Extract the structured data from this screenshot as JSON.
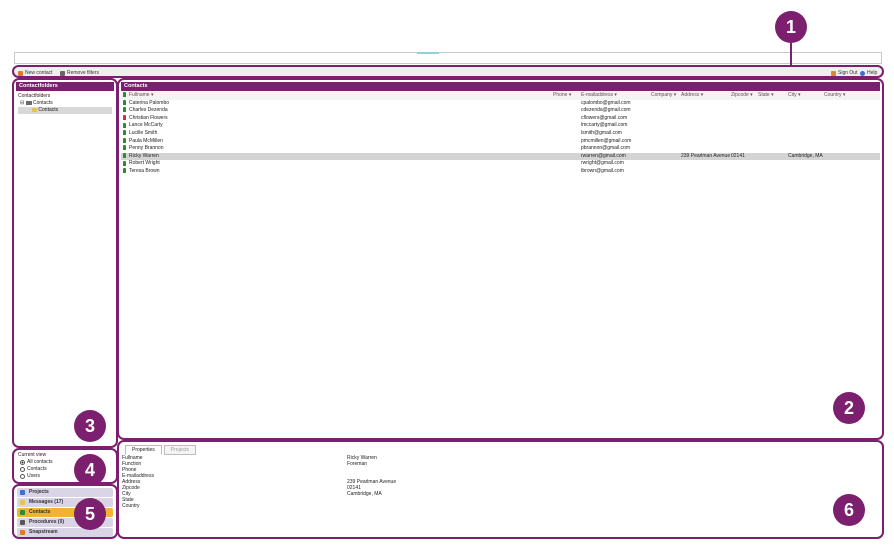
{
  "toolbar": {
    "new_contact": "New contact",
    "remove_filters": "Remove filters",
    "sign_out": "Sign Out",
    "help": "Help"
  },
  "folders": {
    "title": "Contactfolders",
    "tree": [
      "Contactfolders",
      "Contacts",
      "Contacts"
    ]
  },
  "contacts": {
    "title": "Contacts",
    "columns": [
      "Fullname",
      "Phone",
      "E-mailaddress",
      "Company",
      "Address",
      "Zipcode",
      "State",
      "City",
      "Country"
    ],
    "rows": [
      {
        "name": "Caterina Palombo",
        "email": "cpalombo@gmail.com",
        "address": "",
        "zip": "",
        "city": ""
      },
      {
        "name": "Charles Dezenda",
        "email": "cdezenda@gmail.com",
        "address": "",
        "zip": "",
        "city": ""
      },
      {
        "name": "Christian Flowers",
        "email": "cflowers@gmail.com",
        "address": "",
        "zip": "",
        "city": ""
      },
      {
        "name": "Lance McCarty",
        "email": "lmccarty@gmail.com",
        "address": "",
        "zip": "",
        "city": ""
      },
      {
        "name": "Lucille Smith",
        "email": "lsmith@gmail.com",
        "address": "",
        "zip": "",
        "city": ""
      },
      {
        "name": "Paula McMillen",
        "email": "pmcmillen@gmail.com",
        "address": "",
        "zip": "",
        "city": ""
      },
      {
        "name": "Penny Brannon",
        "email": "pbrannon@gmail.com",
        "address": "",
        "zip": "",
        "city": ""
      },
      {
        "name": "Ricky Warren",
        "email": "rwarren@gmail.com",
        "address": "239 Pearlman Avenue",
        "zip": "02141",
        "city": "Cambridge, MA"
      },
      {
        "name": "Robert Wright",
        "email": "rwright@gmail.com",
        "address": "",
        "zip": "",
        "city": ""
      },
      {
        "name": "Teresa Brown",
        "email": "tbrown@gmail.com",
        "address": "",
        "zip": "",
        "city": ""
      }
    ]
  },
  "current_view": {
    "label": "Current view",
    "options": [
      "All contacts",
      "Contacts",
      "Users"
    ],
    "selected": "All contacts"
  },
  "nav": {
    "items": [
      "Projects",
      "Messages (17)",
      "Contacts",
      "Procedures (0)",
      "Snapstream"
    ],
    "active": "Contacts"
  },
  "details": {
    "tabs": [
      "Properties",
      "Projects"
    ],
    "labels": [
      "Fullname",
      "Function",
      "Phone",
      "E-mailaddress",
      "Address",
      "Zipcode",
      "City",
      "State",
      "Country"
    ],
    "values": [
      "Ricky Warren",
      "Foreman",
      "",
      "",
      "239 Pearlman Avenue",
      "02141",
      "Cambridge, MA",
      "",
      ""
    ]
  },
  "badges": [
    "1",
    "2",
    "3",
    "4",
    "5",
    "6"
  ],
  "colors": {
    "accent": "#7b1f6e",
    "nav_active": "#f2b233",
    "nav_item": "#d9d4e6",
    "person_icon": "#2e8b2e"
  }
}
